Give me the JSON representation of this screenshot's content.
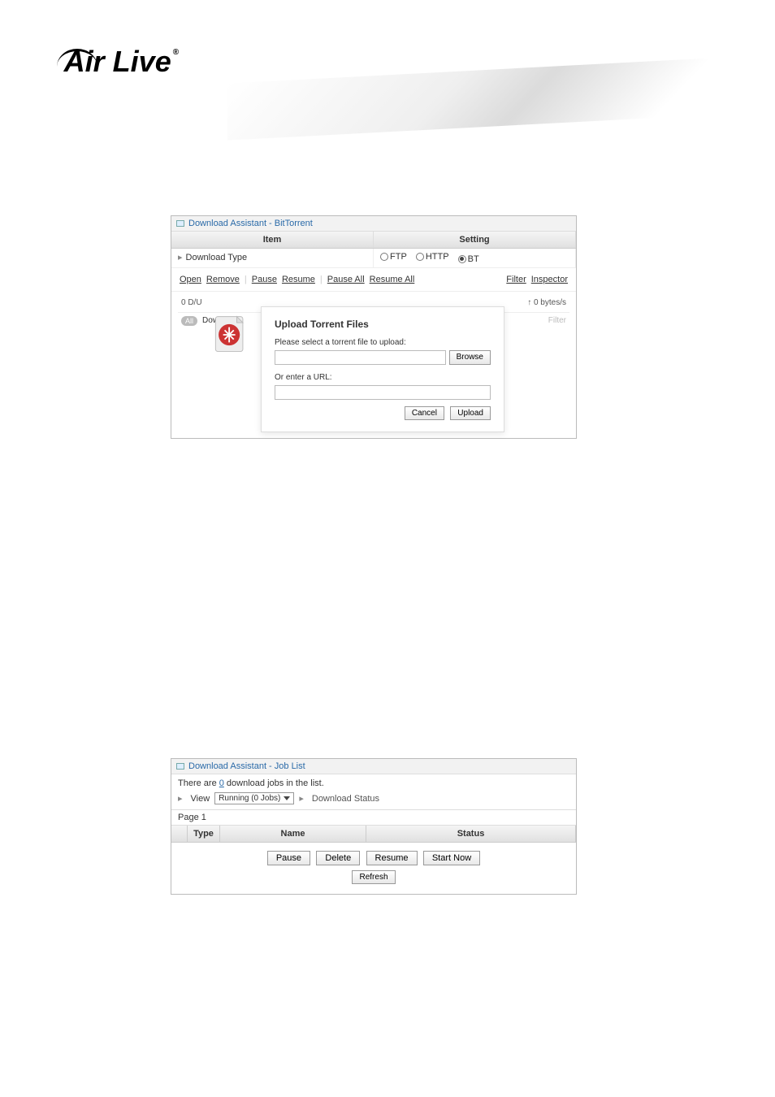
{
  "logo": {
    "text": "Air Live",
    "reg": "®"
  },
  "bt_panel": {
    "title": "Download Assistant - BitTorrent",
    "head": {
      "item": "Item",
      "setting": "Setting"
    },
    "download_type_label": "Download Type",
    "radios": {
      "ftp": "FTP",
      "http": "HTTP",
      "bt": "BT"
    },
    "toolbar": {
      "open": "Open",
      "remove": "Remove",
      "pause": "Pause",
      "resume": "Resume",
      "pause_all": "Pause All",
      "resume_all": "Resume All",
      "filter": "Filter",
      "inspector": "Inspector"
    },
    "top_left": "0 D/U",
    "top_right": "↑ 0 bytes/s",
    "row_badge": "All",
    "row_down": "Down",
    "row_filter": "Filter",
    "modal": {
      "title": "Upload Torrent Files",
      "select_lbl": "Please select a torrent file to upload:",
      "browse": "Browse",
      "url_lbl": "Or enter a URL:",
      "cancel": "Cancel",
      "upload": "Upload"
    }
  },
  "job_panel": {
    "title": "Download Assistant - Job List",
    "info_pre": "There are ",
    "info_count": "0",
    "info_post": " download jobs in the list.",
    "view_lbl": "View",
    "view_select": "Running (0 Jobs)",
    "status_link": "Download Status",
    "page": "Page 1",
    "head": {
      "type": "Type",
      "name": "Name",
      "status": "Status"
    },
    "actions": {
      "pause": "Pause",
      "delete": "Delete",
      "resume": "Resume",
      "start": "Start Now",
      "refresh": "Refresh"
    }
  }
}
